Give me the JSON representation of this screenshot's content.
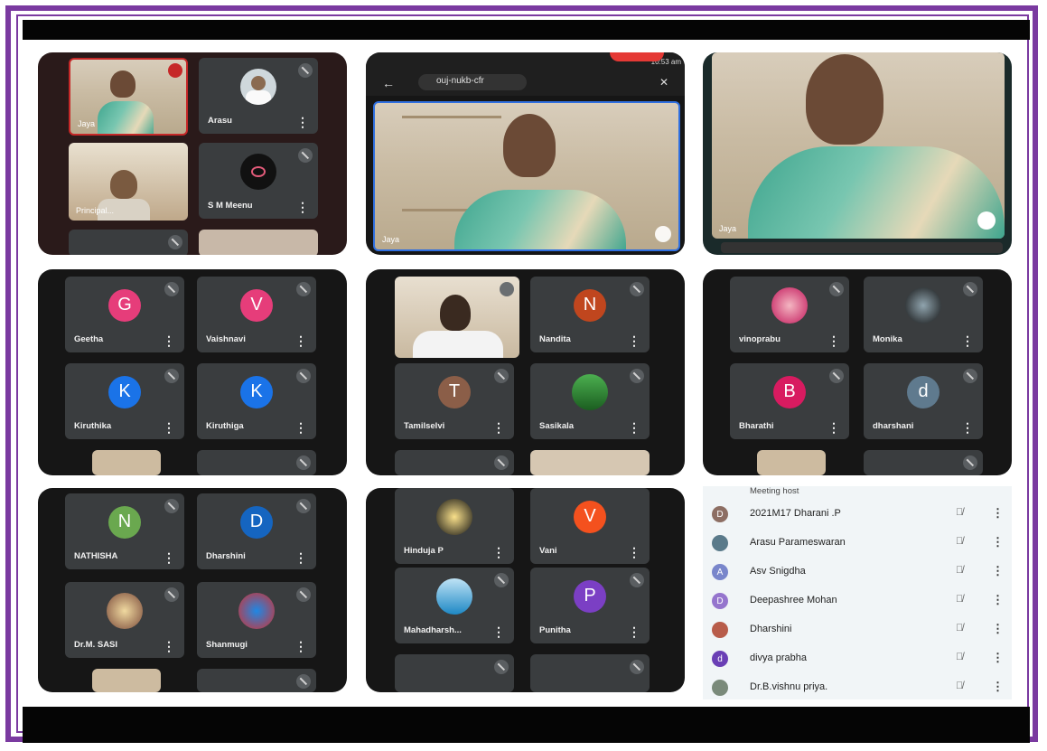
{
  "colors": {
    "frame": "#7a3aa0",
    "panel_bg": "#161616",
    "tile_bg": "#3a3d3f",
    "list_bg": "#f1f5f7"
  },
  "panel1": {
    "tiles": [
      {
        "name": "Jaya",
        "type": "video"
      },
      {
        "name": "Arasu",
        "type": "photo"
      },
      {
        "name": "Principal...",
        "type": "video"
      },
      {
        "name": "S M Meenu",
        "type": "photo"
      }
    ]
  },
  "panel2": {
    "url": "ouj-nukb-cfr",
    "time": "10:53 am",
    "speaker": "Jaya"
  },
  "panel3": {
    "speaker": "Jaya"
  },
  "panel4": {
    "tiles": [
      {
        "name": "Geetha",
        "initial": "G",
        "color": "#e63d7a"
      },
      {
        "name": "Vaishnavi",
        "initial": "V",
        "color": "#e63d7a"
      },
      {
        "name": "Kiruthika",
        "initial": "K",
        "color": "#1a73e8"
      },
      {
        "name": "Kiruthiga",
        "initial": "K",
        "color": "#1a73e8"
      }
    ]
  },
  "panel5": {
    "tiles": [
      {
        "name": "",
        "type": "video"
      },
      {
        "name": "Nandita",
        "initial": "N",
        "color": "#c0461e"
      },
      {
        "name": "Tamilselvi",
        "initial": "T",
        "color": "#8b5e48"
      },
      {
        "name": "Sasikala",
        "type": "photo"
      }
    ]
  },
  "panel6": {
    "tiles": [
      {
        "name": "vinoprabu",
        "type": "photo"
      },
      {
        "name": "Monika",
        "type": "photo"
      },
      {
        "name": "Bharathi",
        "initial": "B",
        "color": "#d81b60"
      },
      {
        "name": "dharshani",
        "initial": "d",
        "color": "#5f7a8e"
      }
    ]
  },
  "panel7": {
    "tiles": [
      {
        "name": "NATHISHA",
        "initial": "N",
        "color": "#6aa84f"
      },
      {
        "name": "Dharshini",
        "initial": "D",
        "color": "#1565c0"
      },
      {
        "name": "Dr.M. SASI",
        "type": "photo"
      },
      {
        "name": "Shanmugi",
        "type": "photo"
      }
    ]
  },
  "panel8": {
    "tiles": [
      {
        "name": "Hinduja P",
        "type": "photo"
      },
      {
        "name": "Vani",
        "initial": "V",
        "color": "#f4511e"
      },
      {
        "name": "Mahadharsh...",
        "type": "photo"
      },
      {
        "name": "Punitha",
        "initial": "P",
        "color": "#7b3fc4"
      }
    ]
  },
  "participants": {
    "role_label": "Meeting host",
    "rows": [
      {
        "name": "2021M17 Dharani .P",
        "initial": "D",
        "color": "#8d6e63"
      },
      {
        "name": "Arasu Parameswaran",
        "initial": "",
        "color": "#5a7a8a"
      },
      {
        "name": "Asv Snigdha",
        "initial": "A",
        "color": "#7986cb"
      },
      {
        "name": "Deepashree Mohan",
        "initial": "D",
        "color": "#9575cd"
      },
      {
        "name": "Dharshini",
        "initial": "",
        "color": "#b85c4a"
      },
      {
        "name": "divya prabha",
        "initial": "d",
        "color": "#6a3fb5"
      },
      {
        "name": "Dr.B.vishnu priya.",
        "initial": "",
        "color": "#7a8a7a"
      }
    ]
  }
}
